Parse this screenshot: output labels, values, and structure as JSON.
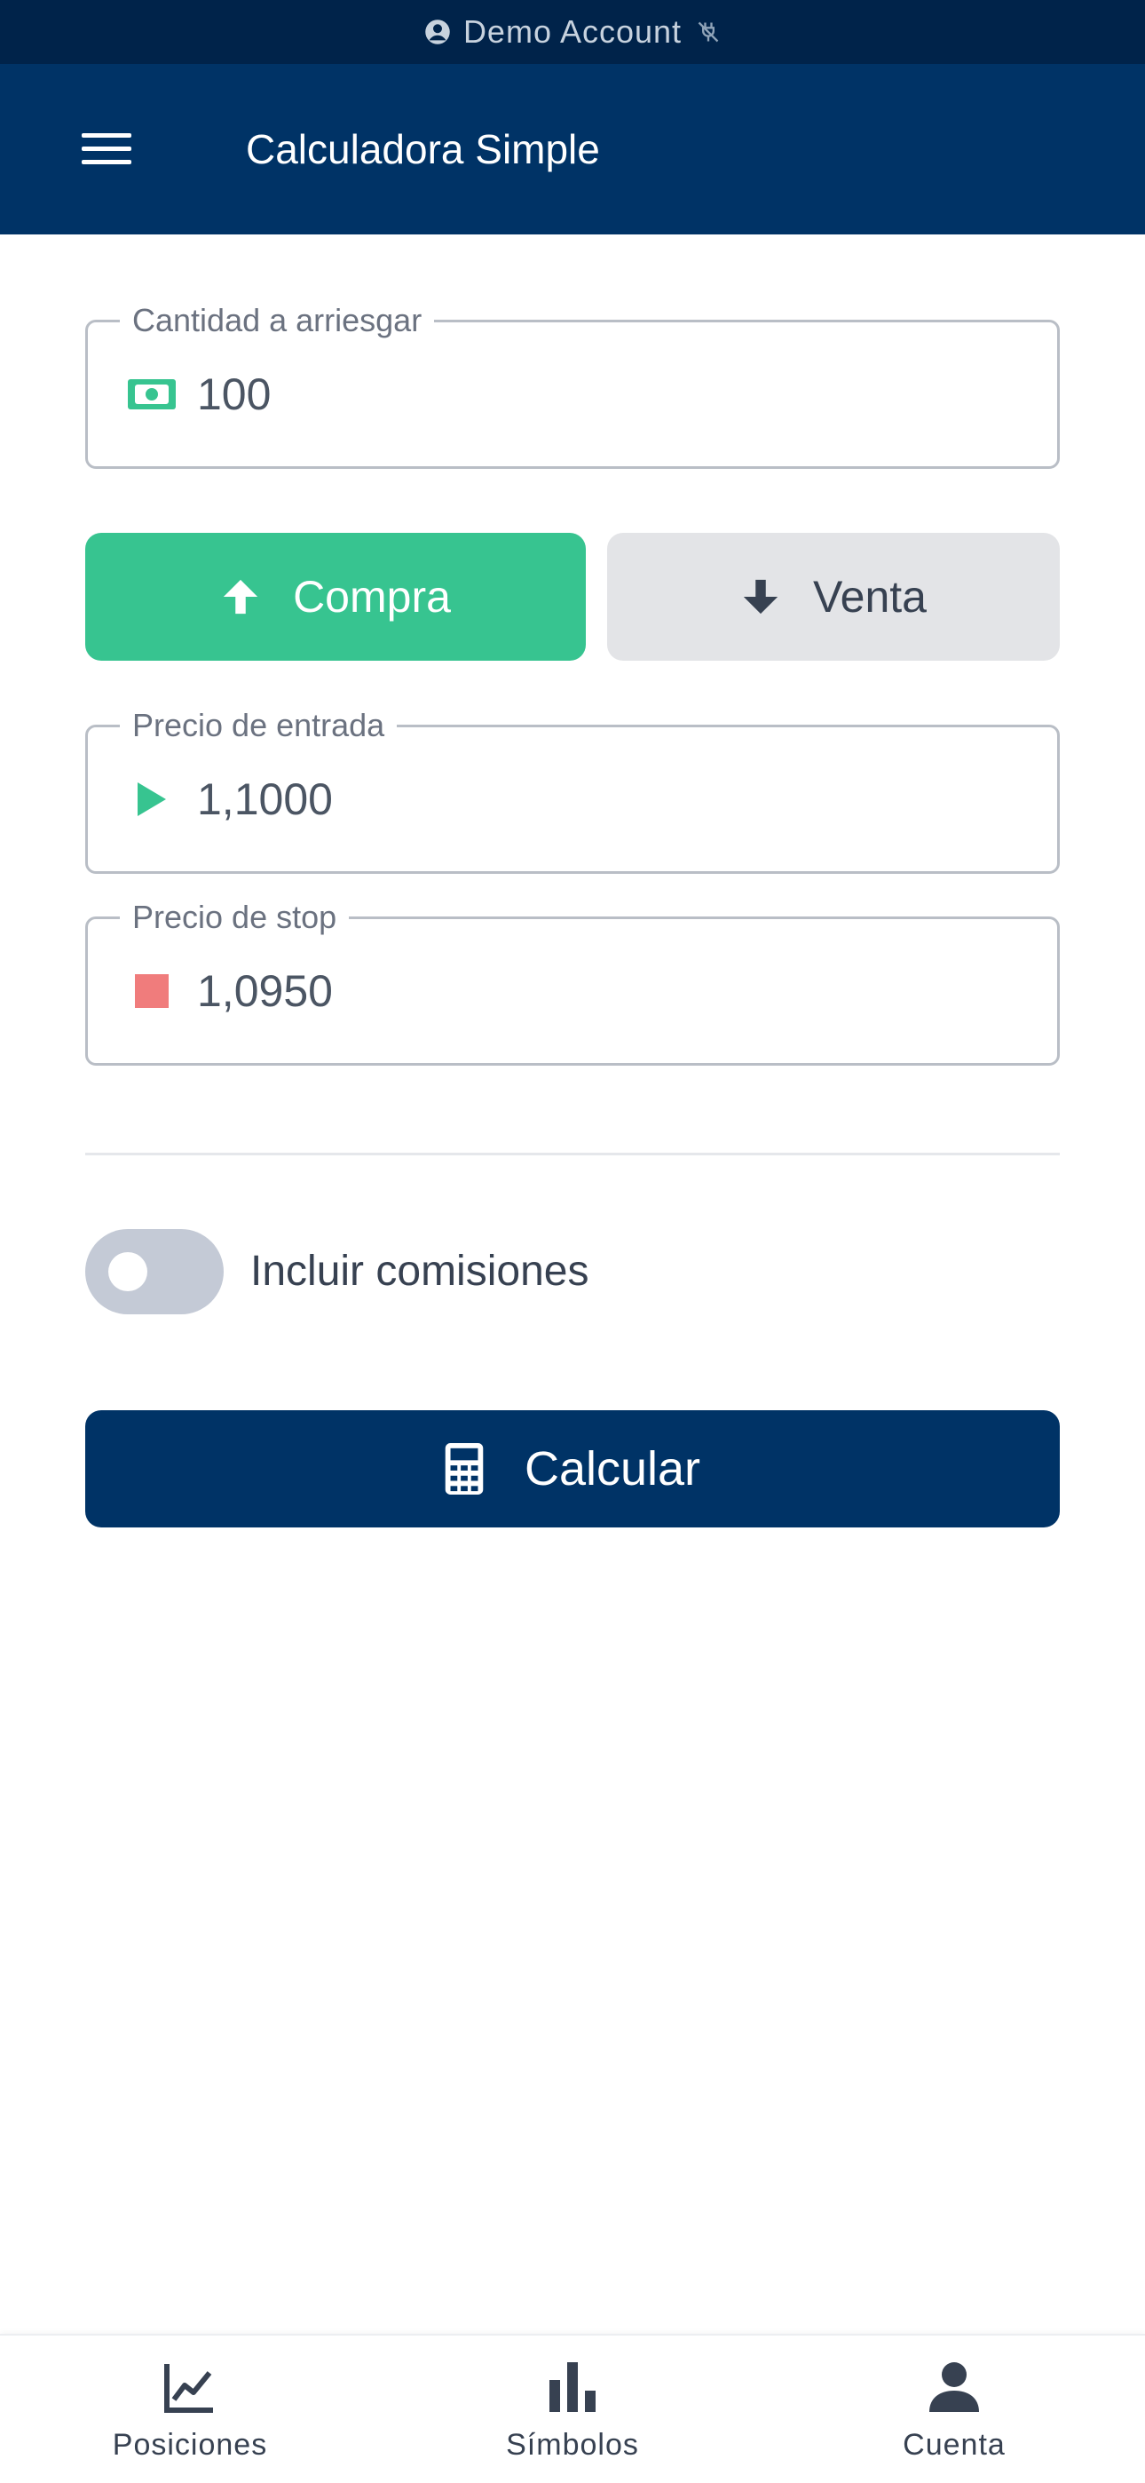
{
  "status_bar": {
    "account_label": "Demo Account",
    "user_icon": "user-circle-icon",
    "plug_icon": "plug-off-icon"
  },
  "app_bar": {
    "title": "Calculadora Simple",
    "menu_icon": "menu-icon"
  },
  "form": {
    "risk_amount": {
      "label": "Cantidad a arriesgar",
      "value": "100",
      "icon": "money-bill-icon"
    },
    "side": {
      "buy_label": "Compra",
      "sell_label": "Venta",
      "selected": "Compra"
    },
    "entry_price": {
      "label": "Precio de entrada",
      "value": "1,1000",
      "icon": "play-icon"
    },
    "stop_price": {
      "label": "Precio de stop",
      "value": "1,0950",
      "icon": "stop-icon"
    },
    "commissions": {
      "label": "Incluir comisiones",
      "enabled": false
    },
    "calculate_label": "Calcular"
  },
  "bottom_nav": [
    {
      "label": "Posiciones",
      "icon": "line-chart-icon"
    },
    {
      "label": "Símbolos",
      "icon": "bar-chart-icon"
    },
    {
      "label": "Cuenta",
      "icon": "person-icon"
    }
  ],
  "colors": {
    "status_bar": "#00234a",
    "app_bar": "#003366",
    "buy": "#37c490",
    "sell": "#e3e4e7",
    "stop": "#f07c7c",
    "toggle_off": "#c4cad6"
  }
}
